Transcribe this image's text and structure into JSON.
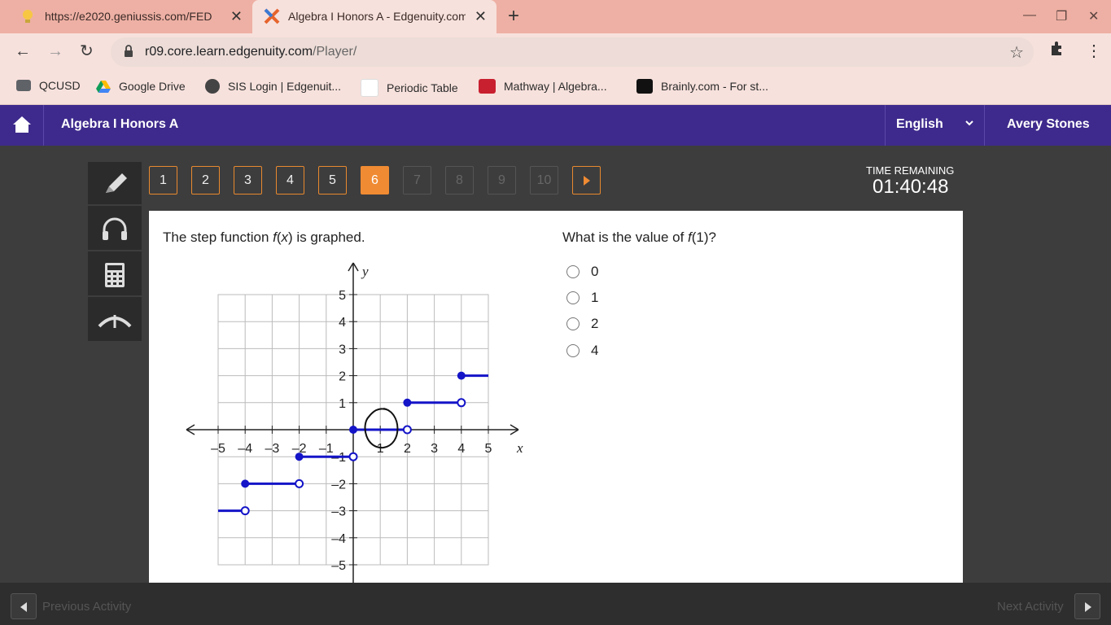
{
  "browser": {
    "tabs": [
      {
        "title": "https://e2020.geniussis.com/FED",
        "favicon": "lightbulb-icon"
      },
      {
        "title": "Algebra I Honors A - Edgenuity.com",
        "favicon": "edgenuity-icon"
      }
    ],
    "url_host": "r09.core.learn.edgenuity.com",
    "url_path": "/Player/",
    "bookmarks": [
      {
        "label": "QCUSD",
        "icon": "folder-icon"
      },
      {
        "label": "Google Drive",
        "icon": "google-drive-icon"
      },
      {
        "label": "SIS Login | Edgenuit...",
        "icon": "globe-icon"
      },
      {
        "label": "Periodic Table",
        "icon": "blank-page-icon"
      },
      {
        "label": "Mathway | Algebra...",
        "icon": "mathway-icon"
      },
      {
        "label": "Brainly.com - For st...",
        "icon": "brainly-icon"
      }
    ]
  },
  "app": {
    "course_title": "Algebra I Honors A",
    "language": "English",
    "user_name": "Avery Stones",
    "accent": "#3e2a8c"
  },
  "test": {
    "question_numbers": [
      "1",
      "2",
      "3",
      "4",
      "5",
      "6",
      "7",
      "8",
      "9",
      "10"
    ],
    "current_question": "6",
    "time_label": "TIME REMAINING",
    "time_value": "01:40:48"
  },
  "question": {
    "prompt_pre": "The step function ",
    "prompt_fn": "f",
    "prompt_mid": "(",
    "prompt_var": "x",
    "prompt_post": ") is graphed.",
    "ask_pre": "What is the value of ",
    "ask_fn": "f",
    "ask_post": "(1)?",
    "choices": [
      "0",
      "1",
      "2",
      "4"
    ]
  },
  "graph": {
    "x_label": "x",
    "y_label": "y",
    "x_ticks": [
      "–5",
      "–4",
      "–3",
      "–2",
      "–1",
      "1",
      "2",
      "3",
      "4",
      "5"
    ],
    "y_ticks": [
      "5",
      "4",
      "3",
      "2",
      "1",
      "–1",
      "–2",
      "–3",
      "–4",
      "–5"
    ],
    "segments": [
      {
        "x1": -5,
        "x2": -4,
        "y": -3,
        "left": "none",
        "right": "open"
      },
      {
        "x1": -4,
        "x2": -2,
        "y": -2,
        "left": "closed",
        "right": "open"
      },
      {
        "x1": -2,
        "x2": 0,
        "y": -1,
        "left": "closed",
        "right": "open"
      },
      {
        "x1": 0,
        "x2": 2,
        "y": 0,
        "left": "closed",
        "right": "open"
      },
      {
        "x1": 2,
        "x2": 4,
        "y": 1,
        "left": "closed",
        "right": "open"
      },
      {
        "x1": 4,
        "x2": 5,
        "y": 2,
        "left": "closed",
        "right": "none"
      }
    ],
    "line_color": "#1414c8"
  },
  "footer": {
    "prev_label": "Previous Activity",
    "next_label": "Next Activity"
  }
}
